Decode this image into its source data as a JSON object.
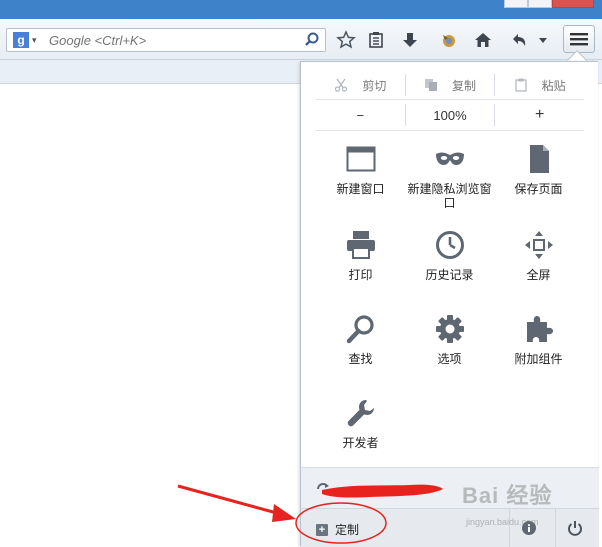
{
  "toolbar": {
    "search_placeholder": "Google <Ctrl+K>",
    "engine_letter": "g"
  },
  "panel": {
    "edit": {
      "cut": "剪切",
      "copy": "复制",
      "paste": "粘贴"
    },
    "zoom": {
      "out": "−",
      "level": "100%",
      "in": "+"
    },
    "items": [
      {
        "label": "新建窗口",
        "icon": "new-window-icon"
      },
      {
        "label": "新建隐私浏览窗口",
        "icon": "private-mask-icon"
      },
      {
        "label": "保存页面",
        "icon": "save-page-icon"
      },
      {
        "label": "打印",
        "icon": "print-icon"
      },
      {
        "label": "历史记录",
        "icon": "history-clock-icon"
      },
      {
        "label": "全屏",
        "icon": "fullscreen-icon"
      },
      {
        "label": "查找",
        "icon": "find-magnifier-icon"
      },
      {
        "label": "选项",
        "icon": "options-gear-icon"
      },
      {
        "label": "附加组件",
        "icon": "addons-puzzle-icon"
      },
      {
        "label": "开发者",
        "icon": "developer-wrench-icon"
      }
    ],
    "customize_label": "定制"
  },
  "watermark": {
    "brand": "Bai 经验",
    "url": "jingyan.baidu.com"
  },
  "colors": {
    "accent": "#3e83c9",
    "icon_gray": "#5f6772",
    "annotation_red": "#e8231f"
  }
}
